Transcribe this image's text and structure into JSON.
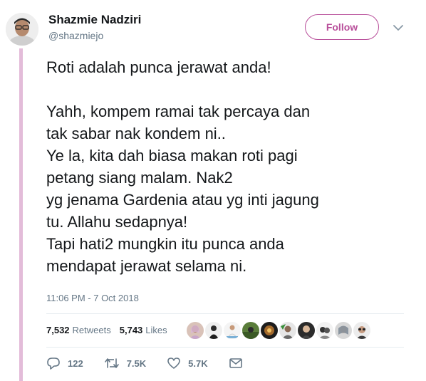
{
  "author": {
    "name": "Shazmie Nadziri",
    "handle": "@shazmiejo"
  },
  "follow_label": "Follow",
  "tweet": {
    "lines": [
      "Roti adalah punca jerawat anda!",
      "",
      "Yahh, kompem ramai tak percaya dan",
      "tak sabar nak kondem ni..",
      "Ye la, kita dah biasa makan roti pagi",
      "petang siang malam. Nak2",
      "yg jenama Gardenia atau yg inti jagung",
      "tu. Allahu sedapnya!",
      "Tapi hati2 mungkin itu punca anda",
      "mendapat jerawat selama ni."
    ],
    "timestamp": "11:06 PM - 7 Oct 2018"
  },
  "stats": {
    "retweets_count": "7,532",
    "retweets_label": "Retweets",
    "likes_count": "5,743",
    "likes_label": "Likes"
  },
  "actions": {
    "replies": "122",
    "retweets": "7.5K",
    "likes": "5.7K"
  },
  "icons": {
    "reply": "reply-icon",
    "retweet": "retweet-icon",
    "like": "heart-icon",
    "message": "envelope-icon",
    "more": "chevron-down-icon"
  },
  "colors": {
    "accent": "#b84e9a",
    "thread_line": "#e3bcd9",
    "muted": "#657786",
    "text": "#14171a"
  }
}
